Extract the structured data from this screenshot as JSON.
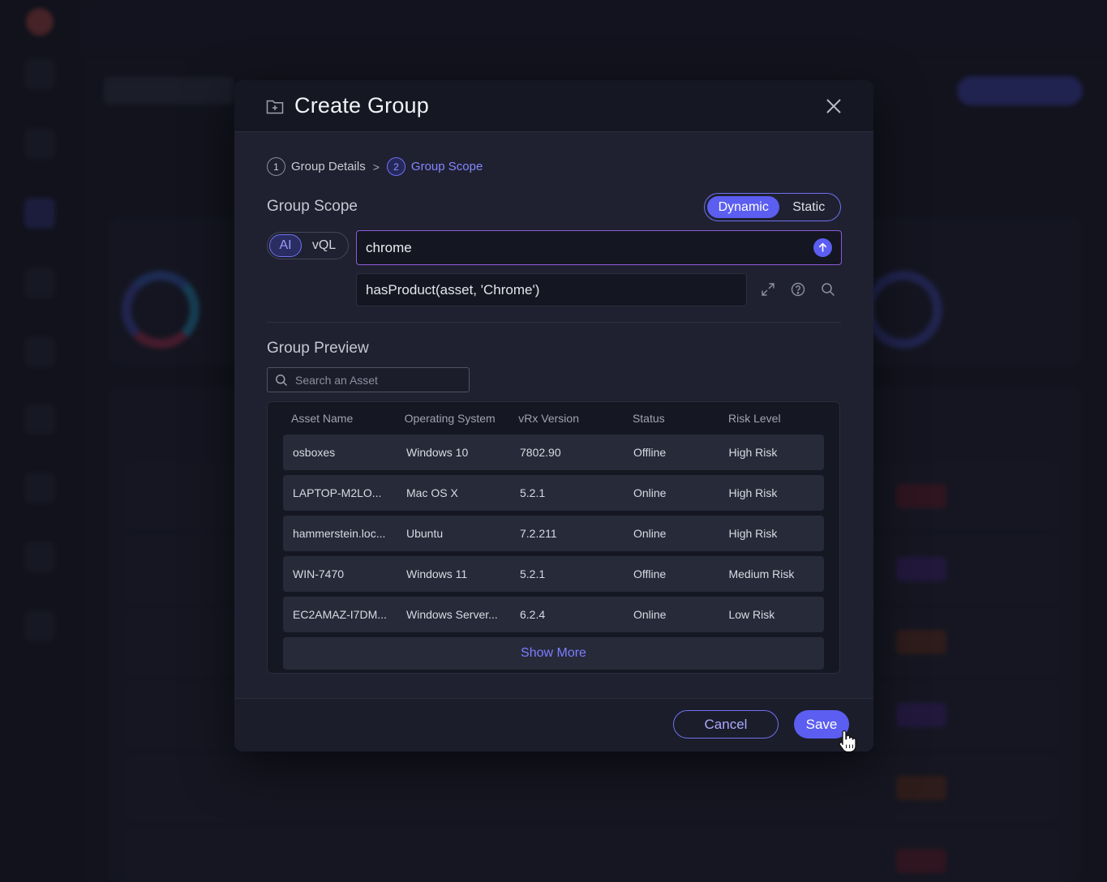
{
  "modal": {
    "title": "Create Group",
    "steps": [
      {
        "number": "1",
        "label": "Group Details"
      },
      {
        "number": "2",
        "label": "Group Scope"
      }
    ],
    "step_separator": ">",
    "scope": {
      "title": "Group Scope",
      "mode_options": [
        "Dynamic",
        "Static"
      ],
      "selected_mode": "Dynamic",
      "lang_options": [
        "AI",
        "vQL"
      ],
      "selected_lang": "AI",
      "query_value": "chrome",
      "generated_vql": "hasProduct(asset, 'Chrome')"
    },
    "preview": {
      "title": "Group Preview",
      "search_placeholder": "Search an Asset",
      "columns": [
        "Asset Name",
        "Operating System",
        "vRx Version",
        "Status",
        "Risk Level"
      ],
      "rows": [
        [
          "osboxes",
          "Windows 10",
          "7802.90",
          "Offline",
          "High Risk"
        ],
        [
          "LAPTOP-M2LO...",
          "Mac OS X",
          "5.2.1",
          "Online",
          "High Risk"
        ],
        [
          "hammerstein.loc...",
          "Ubuntu",
          "7.2.211",
          "Online",
          "High Risk"
        ],
        [
          "WIN-7470",
          "Windows 11",
          "5.2.1",
          "Offline",
          "Medium Risk"
        ],
        [
          "EC2AMAZ-I7DM...",
          "Windows Server...",
          "6.2.4",
          "Online",
          "Low Risk"
        ]
      ],
      "show_more_label": "Show More"
    },
    "footer": {
      "cancel_label": "Cancel",
      "save_label": "Save"
    }
  },
  "colors": {
    "accent": "#5b5ef0",
    "accent_text": "#8486ff",
    "modal_bg": "#1f2130",
    "input_focus_border": "#8c5bd8"
  },
  "icons": [
    "folder-plus-icon",
    "close-icon",
    "arrow-up-icon",
    "expand-icon",
    "help-icon",
    "search-icon",
    "hand-cursor-icon"
  ]
}
